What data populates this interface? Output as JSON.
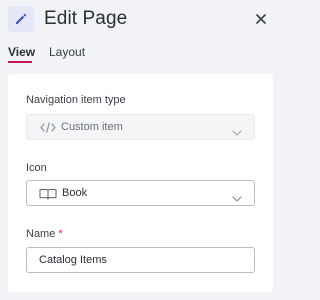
{
  "header": {
    "title": "Edit Page",
    "icon": "pencil-icon",
    "accent": "#3f51b5",
    "close_icon": "close-icon"
  },
  "tabs": [
    {
      "label": "View",
      "active": true
    },
    {
      "label": "Layout",
      "active": false
    }
  ],
  "tab_accent": "#c2185b",
  "form": {
    "nav_type": {
      "label": "Navigation item type",
      "value": "Custom item",
      "icon": "code-icon",
      "disabled": true
    },
    "icon_field": {
      "label": "Icon",
      "value": "Book",
      "icon": "book-icon"
    },
    "name_field": {
      "label": "Name",
      "required_marker": "*",
      "value": "Catalog Items"
    }
  }
}
